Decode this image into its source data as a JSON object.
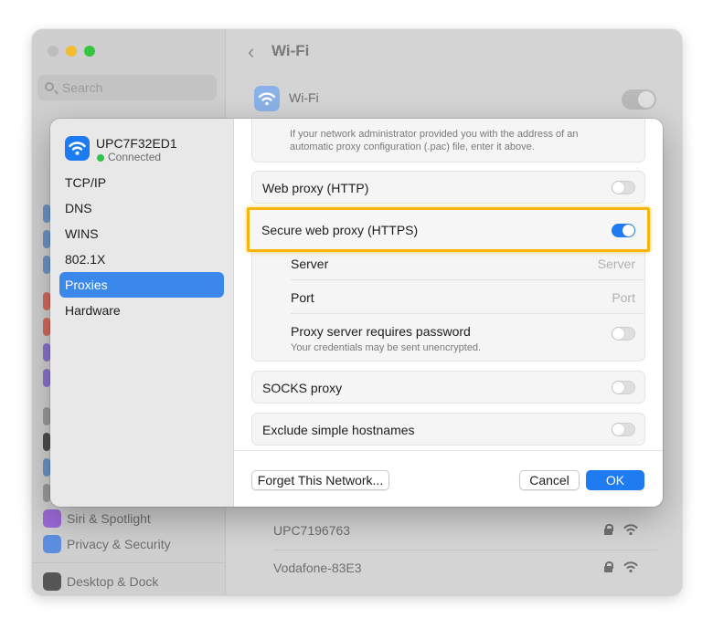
{
  "background_window": {
    "search_placeholder": "Search",
    "title": "Wi-Fi",
    "wifi_label": "Wi-Fi",
    "wifi_enabled": true,
    "sidebar_items": [
      {
        "label": "Siri & Spotlight",
        "icon": "siri-icon",
        "color": "#9b6ad6"
      },
      {
        "label": "Privacy & Security",
        "icon": "hand-icon",
        "color": "#5c8fe0"
      },
      {
        "label": "Desktop & Dock",
        "icon": "dock-icon",
        "color": "#555555"
      }
    ],
    "networks": [
      {
        "name": "UPC7196763",
        "secured": true
      },
      {
        "name": "Vodafone-83E3",
        "secured": true
      }
    ]
  },
  "dialog": {
    "network_name": "UPC7F32ED1",
    "network_status": "Connected",
    "menu": [
      {
        "label": "TCP/IP",
        "selected": false
      },
      {
        "label": "DNS",
        "selected": false
      },
      {
        "label": "WINS",
        "selected": false
      },
      {
        "label": "802.1X",
        "selected": false
      },
      {
        "label": "Proxies",
        "selected": true
      },
      {
        "label": "Hardware",
        "selected": false
      }
    ],
    "pac_help_line1": "If your network administrator provided you with the address of an",
    "pac_help_line2": "automatic proxy configuration (.pac) file, enter it above.",
    "web_proxy": {
      "label": "Web proxy (HTTP)",
      "enabled": false
    },
    "secure_proxy": {
      "label": "Secure web proxy (HTTPS)",
      "enabled": true,
      "server_label": "Server",
      "server_placeholder": "Server",
      "port_label": "Port",
      "port_placeholder": "Port",
      "password_label": "Proxy server requires password",
      "password_help": "Your credentials may be sent unencrypted.",
      "password_enabled": false
    },
    "socks_proxy": {
      "label": "SOCKS proxy",
      "enabled": false
    },
    "exclude_hostnames": {
      "label": "Exclude simple hostnames",
      "enabled": false
    },
    "buttons": {
      "forget": "Forget This Network...",
      "cancel": "Cancel",
      "ok": "OK"
    }
  },
  "colors": {
    "accent": "#1f7bf0",
    "highlight": "#f5b50a",
    "connected": "#33c24d"
  }
}
